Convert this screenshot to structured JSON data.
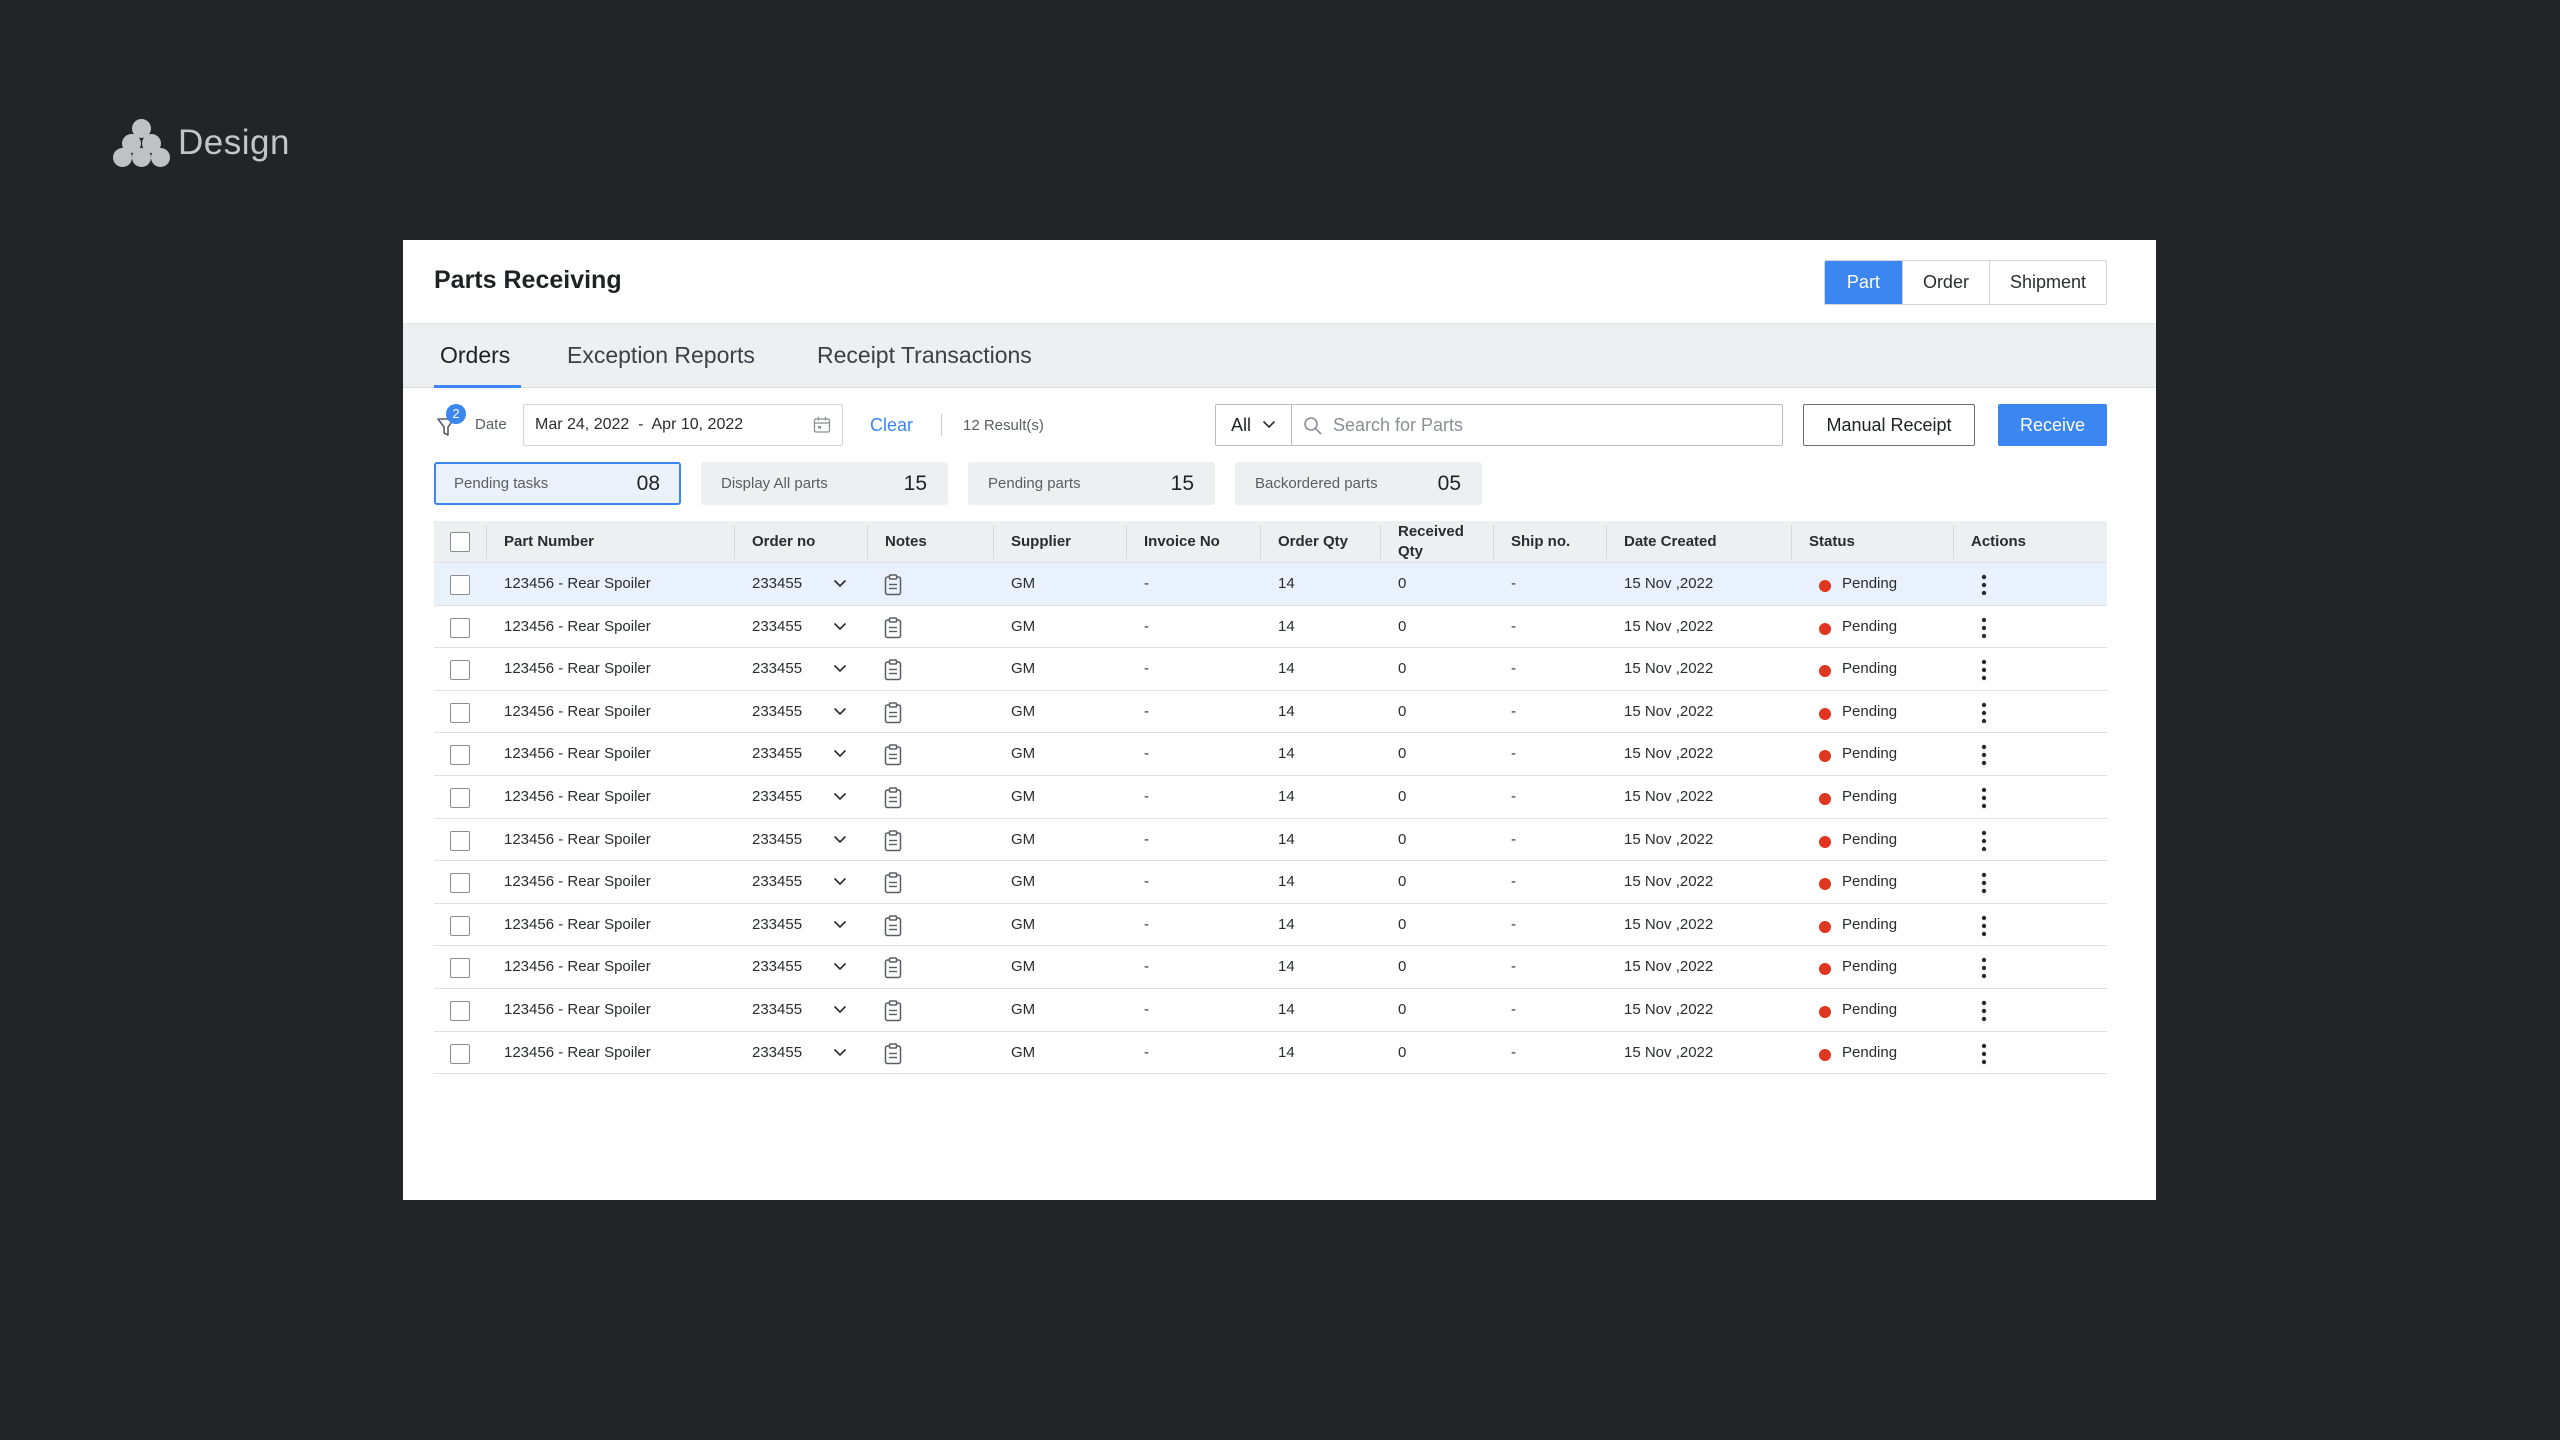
{
  "brand": {
    "name": "Design"
  },
  "page": {
    "title": "Parts Receiving"
  },
  "view_toggle": {
    "items": [
      "Part",
      "Order",
      "Shipment"
    ],
    "active": "Part"
  },
  "tabs": [
    {
      "label": "Orders",
      "active": true
    },
    {
      "label": "Exception Reports",
      "active": false
    },
    {
      "label": "Receipt Transactions",
      "active": false
    }
  ],
  "toolbar": {
    "filter_count": "2",
    "date_label": "Date",
    "date_range": "Mar 24, 2022  -  Apr 10, 2022",
    "clear_label": "Clear",
    "results": "12 Result(s)",
    "search_scope": "All",
    "search_placeholder": "Search for Parts",
    "manual_receipt_label": "Manual Receipt",
    "receive_label": "Receive"
  },
  "chips": [
    {
      "label": "Pending tasks",
      "count": "08",
      "active": true
    },
    {
      "label": "Display All parts",
      "count": "15",
      "active": false
    },
    {
      "label": "Pending parts",
      "count": "15",
      "active": false
    },
    {
      "label": "Backordered parts",
      "count": "05",
      "active": false
    }
  ],
  "table": {
    "columns": {
      "part_number": "Part Number",
      "order_no": "Order no",
      "notes": "Notes",
      "supplier": "Supplier",
      "invoice_no": "Invoice No",
      "order_qty": "Order Qty",
      "received_qty_1": "Received",
      "received_qty_2": "Qty",
      "ship_no": "Ship no.",
      "date_created": "Date Created",
      "status": "Status",
      "actions": "Actions"
    },
    "status_color": "#e0351e",
    "rows": [
      {
        "part": "123456 - Rear Spoiler",
        "order": "233455",
        "supplier": "GM",
        "invoice": "-",
        "order_qty": "14",
        "received_qty": "0",
        "ship": "-",
        "date": "15 Nov ,2022",
        "status": "Pending",
        "selected": true
      },
      {
        "part": "123456 - Rear Spoiler",
        "order": "233455",
        "supplier": "GM",
        "invoice": "-",
        "order_qty": "14",
        "received_qty": "0",
        "ship": "-",
        "date": "15 Nov ,2022",
        "status": "Pending",
        "selected": false
      },
      {
        "part": "123456 - Rear Spoiler",
        "order": "233455",
        "supplier": "GM",
        "invoice": "-",
        "order_qty": "14",
        "received_qty": "0",
        "ship": "-",
        "date": "15 Nov ,2022",
        "status": "Pending",
        "selected": false
      },
      {
        "part": "123456 - Rear Spoiler",
        "order": "233455",
        "supplier": "GM",
        "invoice": "-",
        "order_qty": "14",
        "received_qty": "0",
        "ship": "-",
        "date": "15 Nov ,2022",
        "status": "Pending",
        "selected": false
      },
      {
        "part": "123456 - Rear Spoiler",
        "order": "233455",
        "supplier": "GM",
        "invoice": "-",
        "order_qty": "14",
        "received_qty": "0",
        "ship": "-",
        "date": "15 Nov ,2022",
        "status": "Pending",
        "selected": false
      },
      {
        "part": "123456 - Rear Spoiler",
        "order": "233455",
        "supplier": "GM",
        "invoice": "-",
        "order_qty": "14",
        "received_qty": "0",
        "ship": "-",
        "date": "15 Nov ,2022",
        "status": "Pending",
        "selected": false
      },
      {
        "part": "123456 - Rear Spoiler",
        "order": "233455",
        "supplier": "GM",
        "invoice": "-",
        "order_qty": "14",
        "received_qty": "0",
        "ship": "-",
        "date": "15 Nov ,2022",
        "status": "Pending",
        "selected": false
      },
      {
        "part": "123456 - Rear Spoiler",
        "order": "233455",
        "supplier": "GM",
        "invoice": "-",
        "order_qty": "14",
        "received_qty": "0",
        "ship": "-",
        "date": "15 Nov ,2022",
        "status": "Pending",
        "selected": false
      },
      {
        "part": "123456 - Rear Spoiler",
        "order": "233455",
        "supplier": "GM",
        "invoice": "-",
        "order_qty": "14",
        "received_qty": "0",
        "ship": "-",
        "date": "15 Nov ,2022",
        "status": "Pending",
        "selected": false
      },
      {
        "part": "123456 - Rear Spoiler",
        "order": "233455",
        "supplier": "GM",
        "invoice": "-",
        "order_qty": "14",
        "received_qty": "0",
        "ship": "-",
        "date": "15 Nov ,2022",
        "status": "Pending",
        "selected": false
      },
      {
        "part": "123456 - Rear Spoiler",
        "order": "233455",
        "supplier": "GM",
        "invoice": "-",
        "order_qty": "14",
        "received_qty": "0",
        "ship": "-",
        "date": "15 Nov ,2022",
        "status": "Pending",
        "selected": false
      },
      {
        "part": "123456 - Rear Spoiler",
        "order": "233455",
        "supplier": "GM",
        "invoice": "-",
        "order_qty": "14",
        "received_qty": "0",
        "ship": "-",
        "date": "15 Nov ,2022",
        "status": "Pending",
        "selected": false
      }
    ]
  }
}
